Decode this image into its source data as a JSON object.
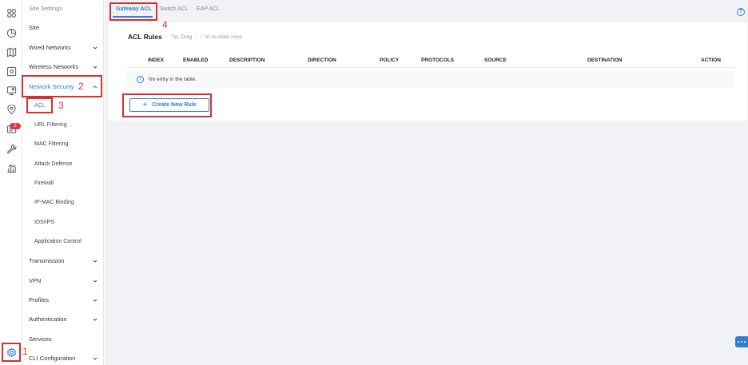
{
  "rail": {
    "icons": [
      "dashboard-icon",
      "statistics-icon",
      "map-icon",
      "devices-icon",
      "clients-icon",
      "insight-icon",
      "log-icon",
      "tools-icon",
      "reports-icon",
      "settings-icon"
    ],
    "badge_count": "2"
  },
  "sidebar": {
    "heading": "Site Settings",
    "items": [
      {
        "label": "Site",
        "expandable": false
      },
      {
        "label": "Wired Networks",
        "expandable": true
      },
      {
        "label": "Wireless Networks",
        "expandable": true
      },
      {
        "label": "Network Security",
        "expandable": true,
        "expanded": true
      }
    ],
    "sub_items": [
      "ACL",
      "URL Filtering",
      "MAC Filtering",
      "Attack Defense",
      "Firewall",
      "IP-MAC Binding",
      "IDS/IPS",
      "Application Control"
    ],
    "items_after": [
      {
        "label": "Transmission",
        "expandable": true
      },
      {
        "label": "VPN",
        "expandable": true
      },
      {
        "label": "Profiles",
        "expandable": true
      },
      {
        "label": "Authentication",
        "expandable": true
      },
      {
        "label": "Services",
        "expandable": false
      },
      {
        "label": "CLI Configuration",
        "expandable": true
      }
    ]
  },
  "tabs": [
    "Gateway ACL",
    "Switch ACL",
    "EAP ACL"
  ],
  "help_label": "?",
  "card": {
    "title": "ACL Rules",
    "tip": "Tip: Drag ⋮⋮ to re-order rows.",
    "columns": [
      "INDEX",
      "ENABLED",
      "DESCRIPTION",
      "DIRECTION",
      "POLICY",
      "PROTOCOLS",
      "SOURCE",
      "DESTINATION",
      "ACTION"
    ],
    "empty_text": "No entry in the table.",
    "create_button": "Create New Rule"
  },
  "callouts": [
    "1",
    "2",
    "3",
    "4"
  ],
  "colors": {
    "accent": "#2f80d1",
    "callout": "#d9302c",
    "badge": "#e0393e"
  }
}
